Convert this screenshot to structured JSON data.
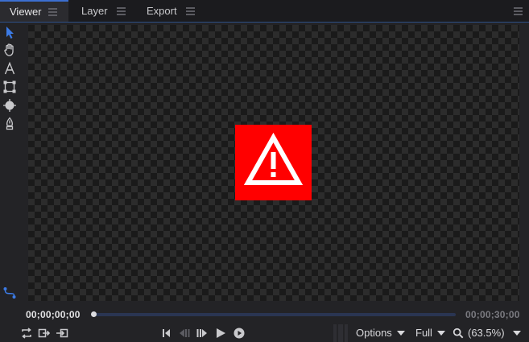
{
  "tabs": [
    {
      "label": "Viewer",
      "active": true
    },
    {
      "label": "Layer",
      "active": false
    },
    {
      "label": "Export",
      "active": false
    }
  ],
  "tools": [
    "select-arrow-icon",
    "hand-icon",
    "text-tool-icon",
    "transform-box-icon",
    "anchor-point-icon",
    "pen-icon"
  ],
  "viewer": {
    "status_icon": "warning-triangle-icon",
    "status_color": "#ff0000"
  },
  "timeline": {
    "start_timecode": "00;00;00;00",
    "end_timecode": "00;00;30;00",
    "position": 0.0
  },
  "bottom_bar": {
    "options_label": "Options",
    "resolution_label": "Full",
    "zoom_label": "(63.5%)"
  },
  "colors": {
    "accent": "#3c6fd0",
    "background": "#232326",
    "tabbar": "#1b1b1e"
  }
}
